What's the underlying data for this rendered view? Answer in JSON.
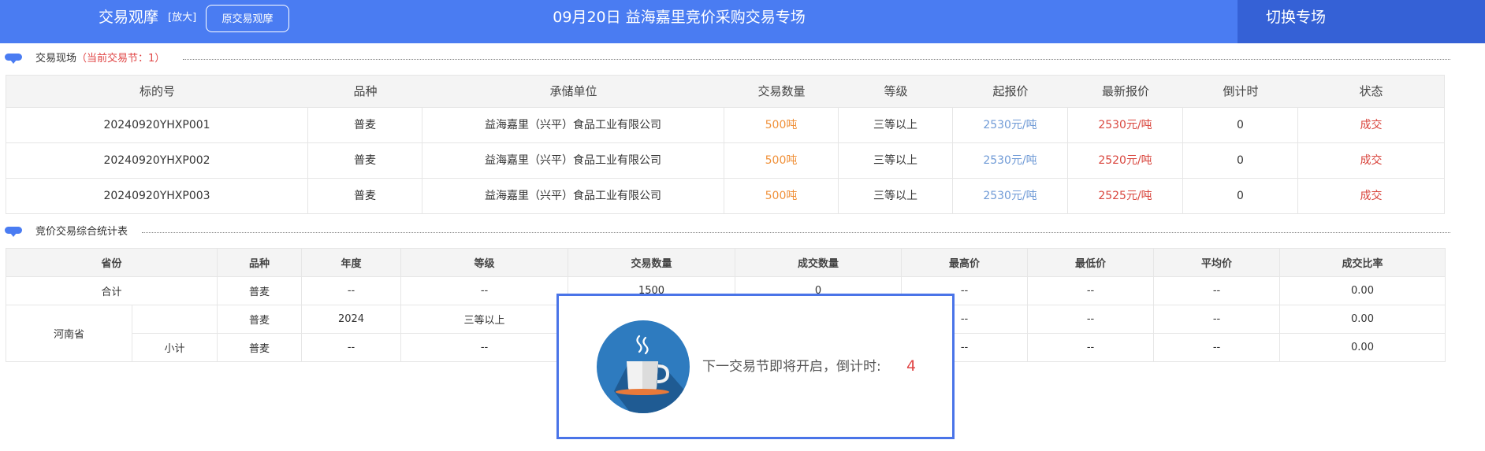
{
  "header": {
    "title": "交易观摩",
    "zoom_label": "[放大]",
    "original_button": "原交易观摩",
    "center_title": "09月20日 益海嘉里竞价采购交易专场",
    "switch_label": "切换专场"
  },
  "section1": {
    "title": "交易现场",
    "subtitle": "（当前交易节：1）"
  },
  "table1": {
    "headers": [
      "标的号",
      "品种",
      "承储单位",
      "交易数量",
      "等级",
      "起报价",
      "最新报价",
      "倒计时",
      "状态"
    ],
    "rows": [
      {
        "id": "20240920YHXP001",
        "variety": "普麦",
        "unit": "益海嘉里（兴平）食品工业有限公司",
        "qty": "500吨",
        "grade": "三等以上",
        "start": "2530元/吨",
        "latest": "2530元/吨",
        "countdown": "0",
        "status": "成交"
      },
      {
        "id": "20240920YHXP002",
        "variety": "普麦",
        "unit": "益海嘉里（兴平）食品工业有限公司",
        "qty": "500吨",
        "grade": "三等以上",
        "start": "2530元/吨",
        "latest": "2520元/吨",
        "countdown": "0",
        "status": "成交"
      },
      {
        "id": "20240920YHXP003",
        "variety": "普麦",
        "unit": "益海嘉里（兴平）食品工业有限公司",
        "qty": "500吨",
        "grade": "三等以上",
        "start": "2530元/吨",
        "latest": "2525元/吨",
        "countdown": "0",
        "status": "成交"
      }
    ]
  },
  "section2": {
    "title": "竞价交易综合统计表"
  },
  "table2": {
    "headers": [
      "省份",
      "品种",
      "年度",
      "等级",
      "交易数量",
      "成交数量",
      "最高价",
      "最低价",
      "平均价",
      "成交比率"
    ],
    "total": {
      "label": "合计",
      "variety": "普麦",
      "year": "--",
      "grade": "--",
      "qty": "1500",
      "deal": "0",
      "max": "--",
      "min": "--",
      "avg": "--",
      "ratio": "0.00"
    },
    "province": "河南省",
    "row1": {
      "variety": "普麦",
      "year": "2024",
      "grade": "三等以上",
      "max": "--",
      "min": "--",
      "avg": "--",
      "ratio": "0.00"
    },
    "row2": {
      "label": "小计",
      "variety": "普麦",
      "year": "--",
      "grade": "--",
      "max": "--",
      "min": "--",
      "avg": "--",
      "ratio": "0.00"
    }
  },
  "popup": {
    "icon": "coffee-cup-icon",
    "text": "下一交易节即将开启，倒计时:",
    "countdown": "4"
  },
  "colors": {
    "header_bg": "#4a7cf2",
    "switch_bg": "#3561d6",
    "accent_red": "#e04545",
    "qty_orange": "#f0913a",
    "price_blue": "#6f9ad6",
    "popup_border": "#4a74e8"
  }
}
